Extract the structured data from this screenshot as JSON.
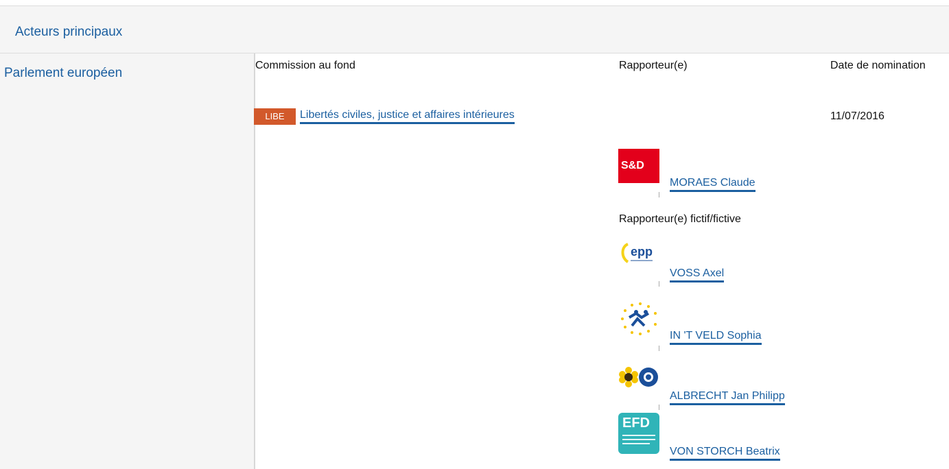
{
  "section": {
    "title": "Acteurs principaux"
  },
  "institution": {
    "label": "Parlement européen"
  },
  "columns": {
    "committee": "Commission au fond",
    "rapporteur": "Rapporteur(e)",
    "date": "Date de nomination"
  },
  "committee": {
    "code": "LIBE",
    "name": "Libertés civiles, justice et affaires intérieures",
    "date": "11/07/2016",
    "code_color": "#d2592b"
  },
  "rapporteur": {
    "group_logo": "S&D",
    "name": "MORAES Claude"
  },
  "shadow": {
    "heading": "Rapporteur(e) fictif/fictive",
    "items": [
      {
        "logo": "epp",
        "name": "VOSS Axel"
      },
      {
        "logo": "alde-stars-icon",
        "name": "IN 'T VELD Sophia"
      },
      {
        "logo": "greens-sunflower-icon",
        "name": "ALBRECHT Jan Philipp"
      },
      {
        "logo": "EFD",
        "name": "VON STORCH Beatrix"
      }
    ]
  }
}
